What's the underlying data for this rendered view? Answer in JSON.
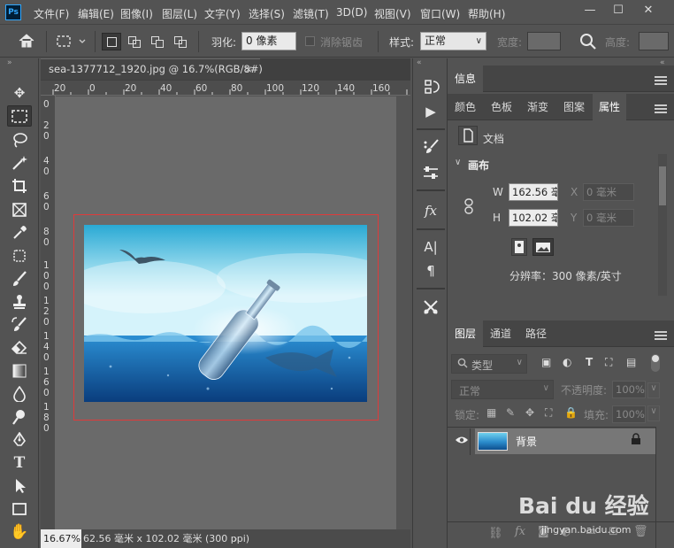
{
  "app": {
    "logo": "Ps"
  },
  "menu": [
    "文件(F)",
    "编辑(E)",
    "图像(I)",
    "图层(L)",
    "文字(Y)",
    "选择(S)",
    "滤镜(T)",
    "3D(D)",
    "视图(V)",
    "窗口(W)",
    "帮助(H)"
  ],
  "window_controls": {
    "minimize": "—",
    "maximize": "☐",
    "close": "✕"
  },
  "options": {
    "feather_label": "羽化:",
    "feather_value": "0 像素",
    "antialias_label": "消除锯齿",
    "style_label": "样式:",
    "style_value": "正常",
    "width_label": "宽度:",
    "height_label": "高度:"
  },
  "document": {
    "tab_title": "sea-1377712_1920.jpg @ 16.7%(RGB/8#)",
    "tab_close": "×",
    "ruler_h": [
      "20",
      "0",
      "20",
      "40",
      "60",
      "80",
      "100",
      "120",
      "140",
      "160"
    ],
    "ruler_v": [
      "0",
      "2",
      "0",
      "4",
      "0",
      "6",
      "0",
      "8",
      "0",
      "1",
      "0",
      "0",
      "1",
      "2",
      "0",
      "1",
      "4",
      "0",
      "1",
      "6",
      "0",
      "1",
      "8",
      "0"
    ],
    "zoom": "16.67%",
    "status": "62.56 毫米 x 102.02 毫米 (300 ppi)",
    "status_arrow": "›"
  },
  "panels": {
    "info_tab": "信息",
    "color_tabs": [
      "颜色",
      "色板",
      "渐变",
      "图案",
      "属性"
    ],
    "properties": {
      "doc_label": "文档",
      "canvas_title": "画布",
      "w_label": "W",
      "w_value": "162.56 毫",
      "h_label": "H",
      "h_value": "102.02 毫",
      "x_label": "X",
      "x_value": "0 毫米",
      "y_label": "Y",
      "y_value": "0 毫米",
      "resolution": "分辨率：300 像素/英寸"
    },
    "layer_tabs": [
      "图层",
      "通道",
      "路径"
    ],
    "layers": {
      "filter_kind": "类型",
      "blend_mode": "正常",
      "opacity_label": "不透明度:",
      "opacity_value": "100%",
      "lock_label": "锁定:",
      "fill_label": "填充:",
      "fill_value": "100%",
      "items": [
        {
          "name": "背景"
        }
      ]
    }
  },
  "watermark": {
    "brand": "Bai du 经验",
    "url": "jingyan.baidu.com"
  },
  "colors": {
    "accent": "#31a8ff",
    "selection": "#e03a3a",
    "ui_bg": "#535353"
  }
}
